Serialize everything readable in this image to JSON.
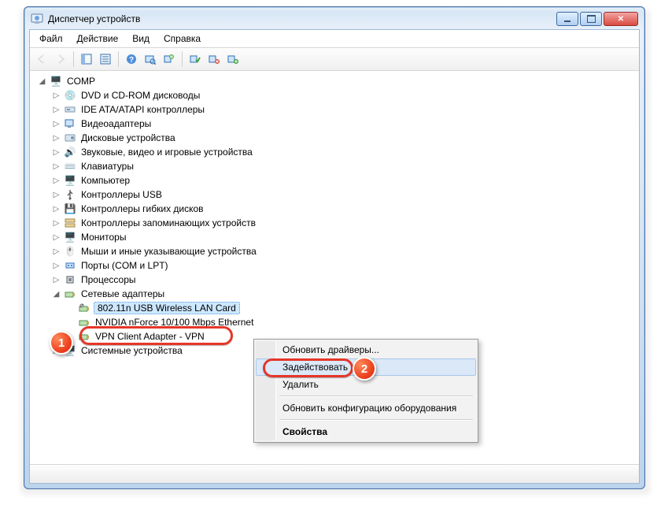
{
  "window": {
    "title": "Диспетчер устройств"
  },
  "menu": {
    "file": "Файл",
    "action": "Действие",
    "view": "Вид",
    "help": "Справка"
  },
  "tree": {
    "root": "COMP",
    "cat_dvd": "DVD и CD-ROM дисководы",
    "cat_ide": "IDE ATA/ATAPI контроллеры",
    "cat_video": "Видеоадаптеры",
    "cat_disk": "Дисковые устройства",
    "cat_sound": "Звуковые, видео и игровые устройства",
    "cat_keyboard": "Клавиатуры",
    "cat_computer": "Компьютер",
    "cat_usb": "Контроллеры USB",
    "cat_floppy": "Контроллеры гибких дисков",
    "cat_storage": "Контроллеры запоминающих устройств",
    "cat_monitor": "Мониторы",
    "cat_mouse": "Мыши и иные указывающие устройства",
    "cat_ports": "Порты (COM и LPT)",
    "cat_cpu": "Процессоры",
    "cat_net": "Сетевые адаптеры",
    "net_wifi": "802.11n USB Wireless LAN Card",
    "net_nforce": "NVIDIA nForce 10/100 Mbps Ethernet",
    "net_vpn": "VPN Client Adapter - VPN",
    "cat_system": "Системные устройства"
  },
  "context_menu": {
    "update_drivers": "Обновить драйверы...",
    "enable": "Задействовать",
    "delete": "Удалить",
    "scan_hardware": "Обновить конфигурацию оборудования",
    "properties": "Свойства"
  },
  "annotations": {
    "marker1": "1",
    "marker2": "2"
  }
}
